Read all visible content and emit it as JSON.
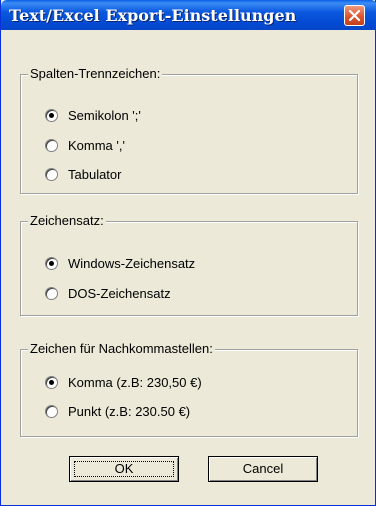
{
  "window": {
    "title": "Text/Excel Export-Einstellungen"
  },
  "groups": [
    {
      "legend": "Spalten-Trennzeichen:",
      "options": [
        {
          "label": "Semikolon ';'",
          "selected": true
        },
        {
          "label": "Komma ','",
          "selected": false
        },
        {
          "label": "Tabulator",
          "selected": false
        }
      ]
    },
    {
      "legend": "Zeichensatz:",
      "options": [
        {
          "label": "Windows-Zeichensatz",
          "selected": true
        },
        {
          "label": "DOS-Zeichensatz",
          "selected": false
        }
      ]
    },
    {
      "legend": "Zeichen für Nachkommastellen:",
      "options": [
        {
          "label": "Komma (z.B: 230,50 €)",
          "selected": true
        },
        {
          "label": "Punkt (z.B: 230.50 €)",
          "selected": false
        }
      ]
    }
  ],
  "buttons": {
    "ok_label": "OK",
    "cancel_label": "Cancel"
  },
  "colors": {
    "title_bar": "#0a58df",
    "dialog_bg": "#ece9d8",
    "close_button": "#dc5530"
  }
}
